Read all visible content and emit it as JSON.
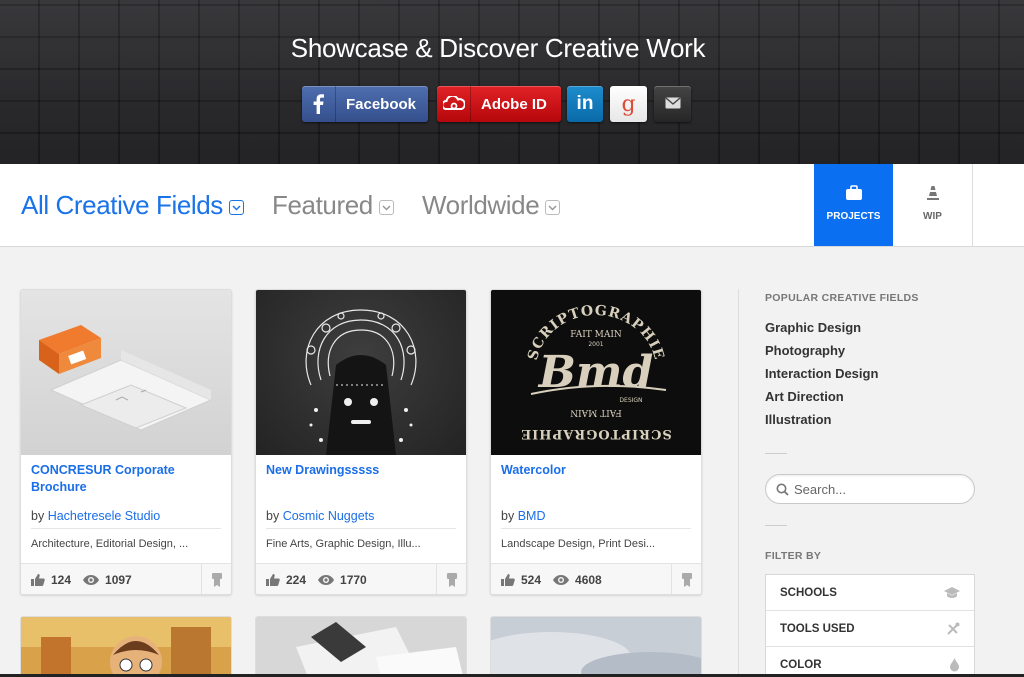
{
  "hero": {
    "title": "Showcase & Discover Creative Work",
    "buttons": {
      "facebook": "Facebook",
      "adobe": "Adobe ID",
      "linkedin": "in",
      "google": "g"
    }
  },
  "nav": {
    "fields": "All Creative Fields",
    "featured": "Featured",
    "region": "Worldwide",
    "tabs": {
      "projects": "PROJECTS",
      "wip": "WIP"
    },
    "accent": "#1a73e8"
  },
  "cards": [
    {
      "title": "CONCRESUR Corporate Brochure",
      "by": "by",
      "owner": "Hachetresele Studio",
      "fields": "Architecture, Editorial Design, ...",
      "likes": "124",
      "views": "1097"
    },
    {
      "title": "New Drawingsssss",
      "by": "by",
      "owner": "Cosmic Nuggets",
      "fields": "Fine Arts, Graphic Design, Illu...",
      "likes": "224",
      "views": "1770"
    },
    {
      "title": "Watercolor",
      "by": "by",
      "owner": "BMD",
      "fields": "Landscape Design, Print Desi...",
      "likes": "524",
      "views": "4608"
    }
  ],
  "thumb3": {
    "arc_top": "SCRIPTOGRAPHIE",
    "fait_main": "FAIT MAIN",
    "year": "2001",
    "logo": "Bmd",
    "design": "DESIGN",
    "arc_bottom_1": "FAIT MAIN",
    "arc_bottom_2": "SCRIPTOGRAPHIE"
  },
  "sidebar": {
    "popular_heading": "POPULAR CREATIVE FIELDS",
    "popular": [
      "Graphic Design",
      "Photography",
      "Interaction Design",
      "Art Direction",
      "Illustration"
    ],
    "search_placeholder": "Search...",
    "filter_heading": "FILTER BY",
    "filters": [
      "SCHOOLS",
      "TOOLS USED",
      "COLOR"
    ]
  }
}
